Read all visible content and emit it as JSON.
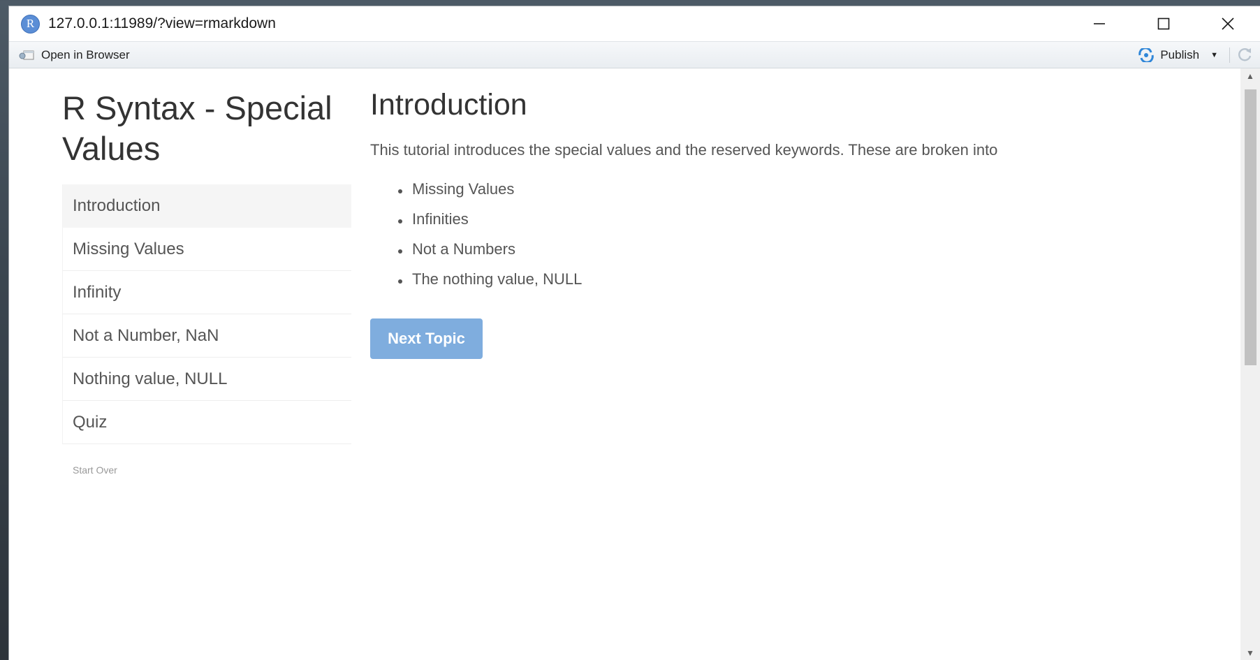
{
  "window": {
    "title": "127.0.0.1:11989/?view=rmarkdown",
    "app_icon_letter": "R"
  },
  "toolbar": {
    "open_in_browser": "Open in Browser",
    "publish": "Publish"
  },
  "sidebar": {
    "title": "R Syntax - Special Values",
    "items": [
      {
        "label": "Introduction",
        "active": true
      },
      {
        "label": "Missing Values",
        "active": false
      },
      {
        "label": "Infinity",
        "active": false
      },
      {
        "label": "Not a Number, NaN",
        "active": false
      },
      {
        "label": "Nothing value, NULL",
        "active": false
      },
      {
        "label": "Quiz",
        "active": false
      }
    ],
    "start_over": "Start Over"
  },
  "main": {
    "heading": "Introduction",
    "intro": "This tutorial introduces the special values and the reserved keywords. These are broken into",
    "topics": [
      "Missing Values",
      "Infinities",
      "Not a Numbers",
      "The nothing value, NULL"
    ],
    "next_button": "Next Topic"
  },
  "colors": {
    "accent": "#7fadde",
    "active_item_bg": "#f5f5f5",
    "text": "#555555"
  }
}
